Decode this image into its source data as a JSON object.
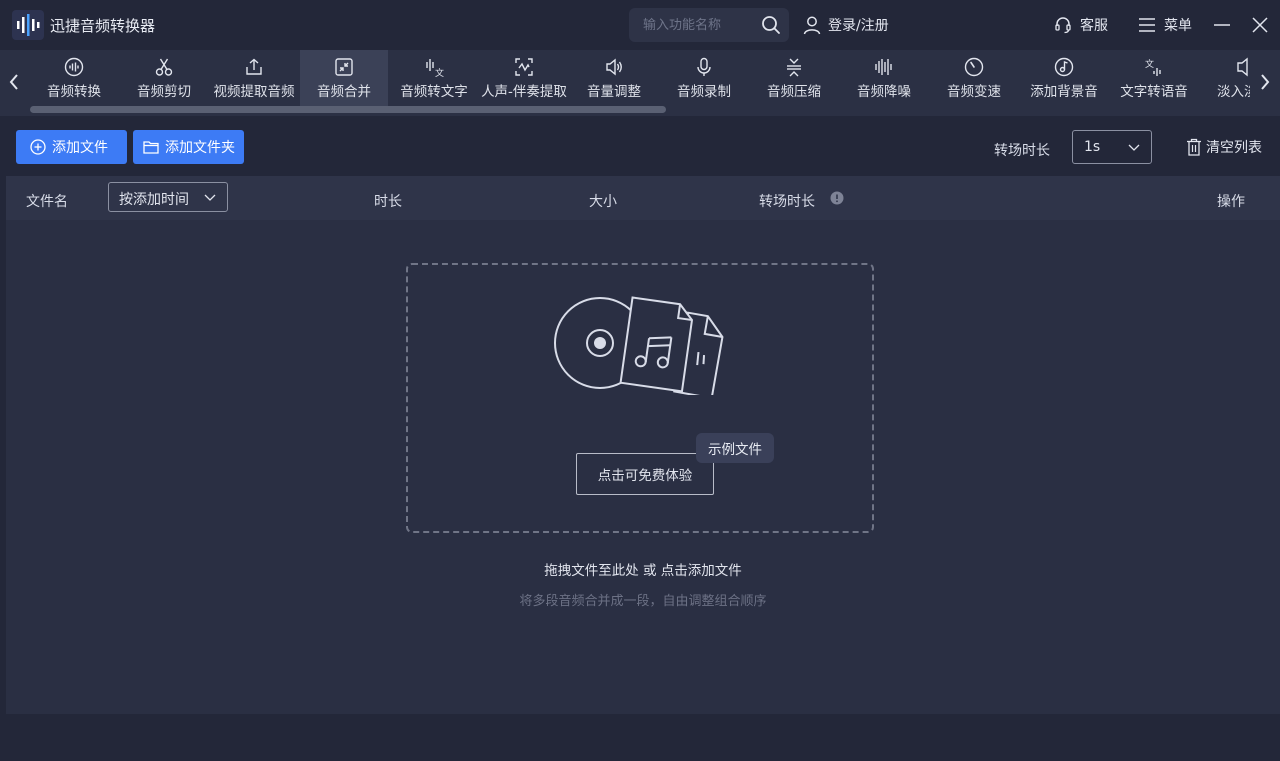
{
  "app": {
    "title": "迅捷音频转换器"
  },
  "header": {
    "search_placeholder": "输入功能名称",
    "login_label": "登录/注册",
    "service_label": "客服",
    "menu_label": "菜单"
  },
  "toolbar": {
    "items": [
      {
        "label": "音频转换",
        "icon": "waveform-circle-icon",
        "active": false
      },
      {
        "label": "音频剪切",
        "icon": "scissors-icon",
        "active": false
      },
      {
        "label": "视频提取音频",
        "icon": "upload-icon",
        "active": false
      },
      {
        "label": "音频合并",
        "icon": "merge-icon",
        "active": true
      },
      {
        "label": "音频转文字",
        "icon": "audio-to-text-icon",
        "active": false
      },
      {
        "label": "人声-伴奏提取",
        "icon": "vocal-extract-icon",
        "active": false
      },
      {
        "label": "音量调整",
        "icon": "speaker-icon",
        "active": false
      },
      {
        "label": "音频录制",
        "icon": "microphone-icon",
        "active": false
      },
      {
        "label": "音频压缩",
        "icon": "compress-icon",
        "active": false
      },
      {
        "label": "音频降噪",
        "icon": "denoise-icon",
        "active": false
      },
      {
        "label": "音频变速",
        "icon": "speed-gauge-icon",
        "active": false
      },
      {
        "label": "添加背景音",
        "icon": "music-note-circle-icon",
        "active": false
      },
      {
        "label": "文字转语音",
        "icon": "text-to-speech-icon",
        "active": false
      },
      {
        "label": "淡入淡出",
        "icon": "fade-icon",
        "active": false
      }
    ]
  },
  "actions": {
    "add_file": "添加文件",
    "add_folder": "添加文件夹",
    "transition_label": "转场时长",
    "transition_value": "1s",
    "clear_list": "清空列表"
  },
  "table": {
    "col_filename": "文件名",
    "sort_value": "按添加时间",
    "col_duration": "时长",
    "col_size": "大小",
    "col_transition": "转场时长",
    "col_action": "操作"
  },
  "dropzone": {
    "try_button": "点击可免费体验",
    "sample_badge": "示例文件",
    "hint_main": "拖拽文件至此处 或 点击添加文件",
    "hint_sub": "将多段音频合并成一段，自由调整组合顺序"
  },
  "colors": {
    "accent": "#3d7bf5",
    "background": "#232739",
    "panel": "#2a2f43"
  }
}
